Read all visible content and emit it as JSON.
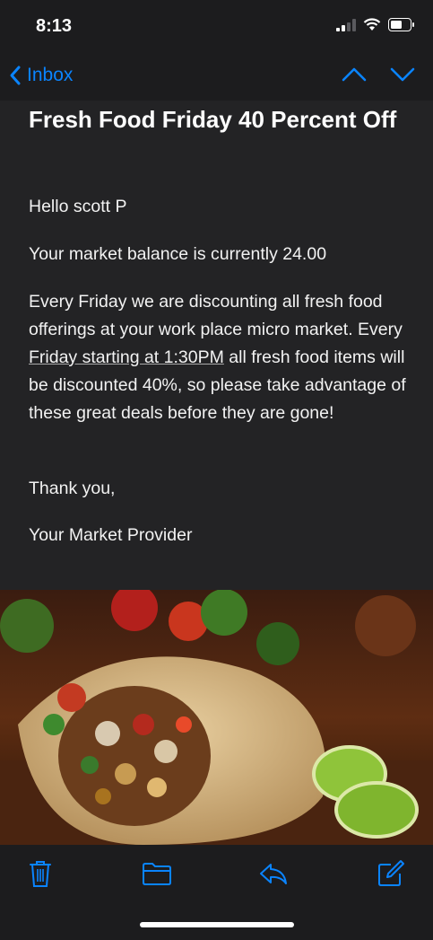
{
  "status": {
    "time": "8:13"
  },
  "nav": {
    "back_label": "Inbox"
  },
  "email": {
    "subject": "Fresh Food Friday 40 Percent Off",
    "greeting": "Hello scott P",
    "balance_line": "Your market balance is currently 24.00",
    "body_before_link": "Every Friday we are discounting all fresh food offerings at your work place micro market.  Every ",
    "body_link": "Friday starting at 1:30PM",
    "body_after_link": " all fresh food items will be discounted 40%, so please take advantage of these great deals before they are gone!",
    "closing": "Thank you,",
    "signature": "Your Market Provider"
  },
  "colors": {
    "accent": "#0a84ff",
    "background": "#1c1c1e",
    "content_bg": "#232325"
  },
  "toolbar": {
    "icons": [
      "trash-icon",
      "folder-icon",
      "reply-icon",
      "compose-icon"
    ]
  }
}
